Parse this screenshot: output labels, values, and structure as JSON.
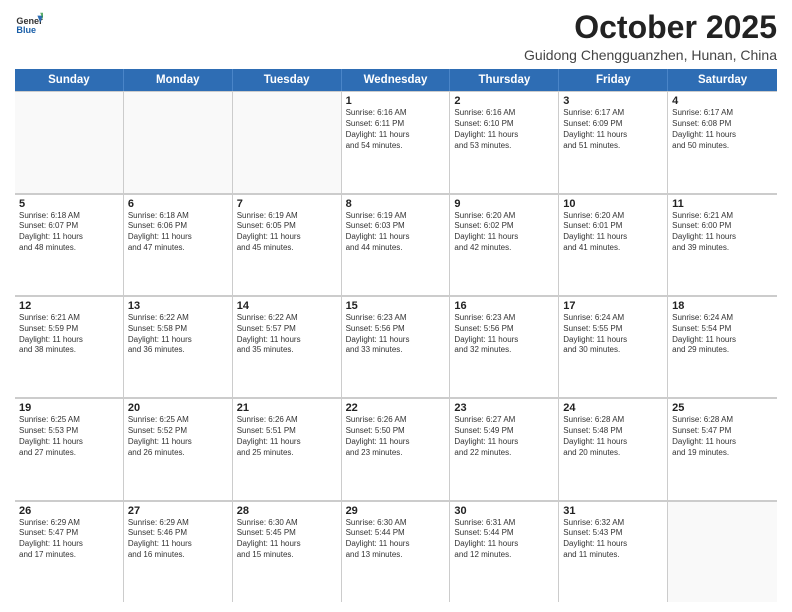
{
  "header": {
    "logo_general": "General",
    "logo_blue": "Blue",
    "month_title": "October 2025",
    "location": "Guidong Chengguanzhen, Hunan, China"
  },
  "weekdays": [
    "Sunday",
    "Monday",
    "Tuesday",
    "Wednesday",
    "Thursday",
    "Friday",
    "Saturday"
  ],
  "rows": [
    [
      {
        "day": "",
        "info": "",
        "empty": true
      },
      {
        "day": "",
        "info": "",
        "empty": true
      },
      {
        "day": "",
        "info": "",
        "empty": true
      },
      {
        "day": "1",
        "info": "Sunrise: 6:16 AM\nSunset: 6:11 PM\nDaylight: 11 hours\nand 54 minutes.",
        "empty": false
      },
      {
        "day": "2",
        "info": "Sunrise: 6:16 AM\nSunset: 6:10 PM\nDaylight: 11 hours\nand 53 minutes.",
        "empty": false
      },
      {
        "day": "3",
        "info": "Sunrise: 6:17 AM\nSunset: 6:09 PM\nDaylight: 11 hours\nand 51 minutes.",
        "empty": false
      },
      {
        "day": "4",
        "info": "Sunrise: 6:17 AM\nSunset: 6:08 PM\nDaylight: 11 hours\nand 50 minutes.",
        "empty": false
      }
    ],
    [
      {
        "day": "5",
        "info": "Sunrise: 6:18 AM\nSunset: 6:07 PM\nDaylight: 11 hours\nand 48 minutes.",
        "empty": false
      },
      {
        "day": "6",
        "info": "Sunrise: 6:18 AM\nSunset: 6:06 PM\nDaylight: 11 hours\nand 47 minutes.",
        "empty": false
      },
      {
        "day": "7",
        "info": "Sunrise: 6:19 AM\nSunset: 6:05 PM\nDaylight: 11 hours\nand 45 minutes.",
        "empty": false
      },
      {
        "day": "8",
        "info": "Sunrise: 6:19 AM\nSunset: 6:03 PM\nDaylight: 11 hours\nand 44 minutes.",
        "empty": false
      },
      {
        "day": "9",
        "info": "Sunrise: 6:20 AM\nSunset: 6:02 PM\nDaylight: 11 hours\nand 42 minutes.",
        "empty": false
      },
      {
        "day": "10",
        "info": "Sunrise: 6:20 AM\nSunset: 6:01 PM\nDaylight: 11 hours\nand 41 minutes.",
        "empty": false
      },
      {
        "day": "11",
        "info": "Sunrise: 6:21 AM\nSunset: 6:00 PM\nDaylight: 11 hours\nand 39 minutes.",
        "empty": false
      }
    ],
    [
      {
        "day": "12",
        "info": "Sunrise: 6:21 AM\nSunset: 5:59 PM\nDaylight: 11 hours\nand 38 minutes.",
        "empty": false
      },
      {
        "day": "13",
        "info": "Sunrise: 6:22 AM\nSunset: 5:58 PM\nDaylight: 11 hours\nand 36 minutes.",
        "empty": false
      },
      {
        "day": "14",
        "info": "Sunrise: 6:22 AM\nSunset: 5:57 PM\nDaylight: 11 hours\nand 35 minutes.",
        "empty": false
      },
      {
        "day": "15",
        "info": "Sunrise: 6:23 AM\nSunset: 5:56 PM\nDaylight: 11 hours\nand 33 minutes.",
        "empty": false
      },
      {
        "day": "16",
        "info": "Sunrise: 6:23 AM\nSunset: 5:56 PM\nDaylight: 11 hours\nand 32 minutes.",
        "empty": false
      },
      {
        "day": "17",
        "info": "Sunrise: 6:24 AM\nSunset: 5:55 PM\nDaylight: 11 hours\nand 30 minutes.",
        "empty": false
      },
      {
        "day": "18",
        "info": "Sunrise: 6:24 AM\nSunset: 5:54 PM\nDaylight: 11 hours\nand 29 minutes.",
        "empty": false
      }
    ],
    [
      {
        "day": "19",
        "info": "Sunrise: 6:25 AM\nSunset: 5:53 PM\nDaylight: 11 hours\nand 27 minutes.",
        "empty": false
      },
      {
        "day": "20",
        "info": "Sunrise: 6:25 AM\nSunset: 5:52 PM\nDaylight: 11 hours\nand 26 minutes.",
        "empty": false
      },
      {
        "day": "21",
        "info": "Sunrise: 6:26 AM\nSunset: 5:51 PM\nDaylight: 11 hours\nand 25 minutes.",
        "empty": false
      },
      {
        "day": "22",
        "info": "Sunrise: 6:26 AM\nSunset: 5:50 PM\nDaylight: 11 hours\nand 23 minutes.",
        "empty": false
      },
      {
        "day": "23",
        "info": "Sunrise: 6:27 AM\nSunset: 5:49 PM\nDaylight: 11 hours\nand 22 minutes.",
        "empty": false
      },
      {
        "day": "24",
        "info": "Sunrise: 6:28 AM\nSunset: 5:48 PM\nDaylight: 11 hours\nand 20 minutes.",
        "empty": false
      },
      {
        "day": "25",
        "info": "Sunrise: 6:28 AM\nSunset: 5:47 PM\nDaylight: 11 hours\nand 19 minutes.",
        "empty": false
      }
    ],
    [
      {
        "day": "26",
        "info": "Sunrise: 6:29 AM\nSunset: 5:47 PM\nDaylight: 11 hours\nand 17 minutes.",
        "empty": false
      },
      {
        "day": "27",
        "info": "Sunrise: 6:29 AM\nSunset: 5:46 PM\nDaylight: 11 hours\nand 16 minutes.",
        "empty": false
      },
      {
        "day": "28",
        "info": "Sunrise: 6:30 AM\nSunset: 5:45 PM\nDaylight: 11 hours\nand 15 minutes.",
        "empty": false
      },
      {
        "day": "29",
        "info": "Sunrise: 6:30 AM\nSunset: 5:44 PM\nDaylight: 11 hours\nand 13 minutes.",
        "empty": false
      },
      {
        "day": "30",
        "info": "Sunrise: 6:31 AM\nSunset: 5:44 PM\nDaylight: 11 hours\nand 12 minutes.",
        "empty": false
      },
      {
        "day": "31",
        "info": "Sunrise: 6:32 AM\nSunset: 5:43 PM\nDaylight: 11 hours\nand 11 minutes.",
        "empty": false
      },
      {
        "day": "",
        "info": "",
        "empty": true
      }
    ]
  ]
}
